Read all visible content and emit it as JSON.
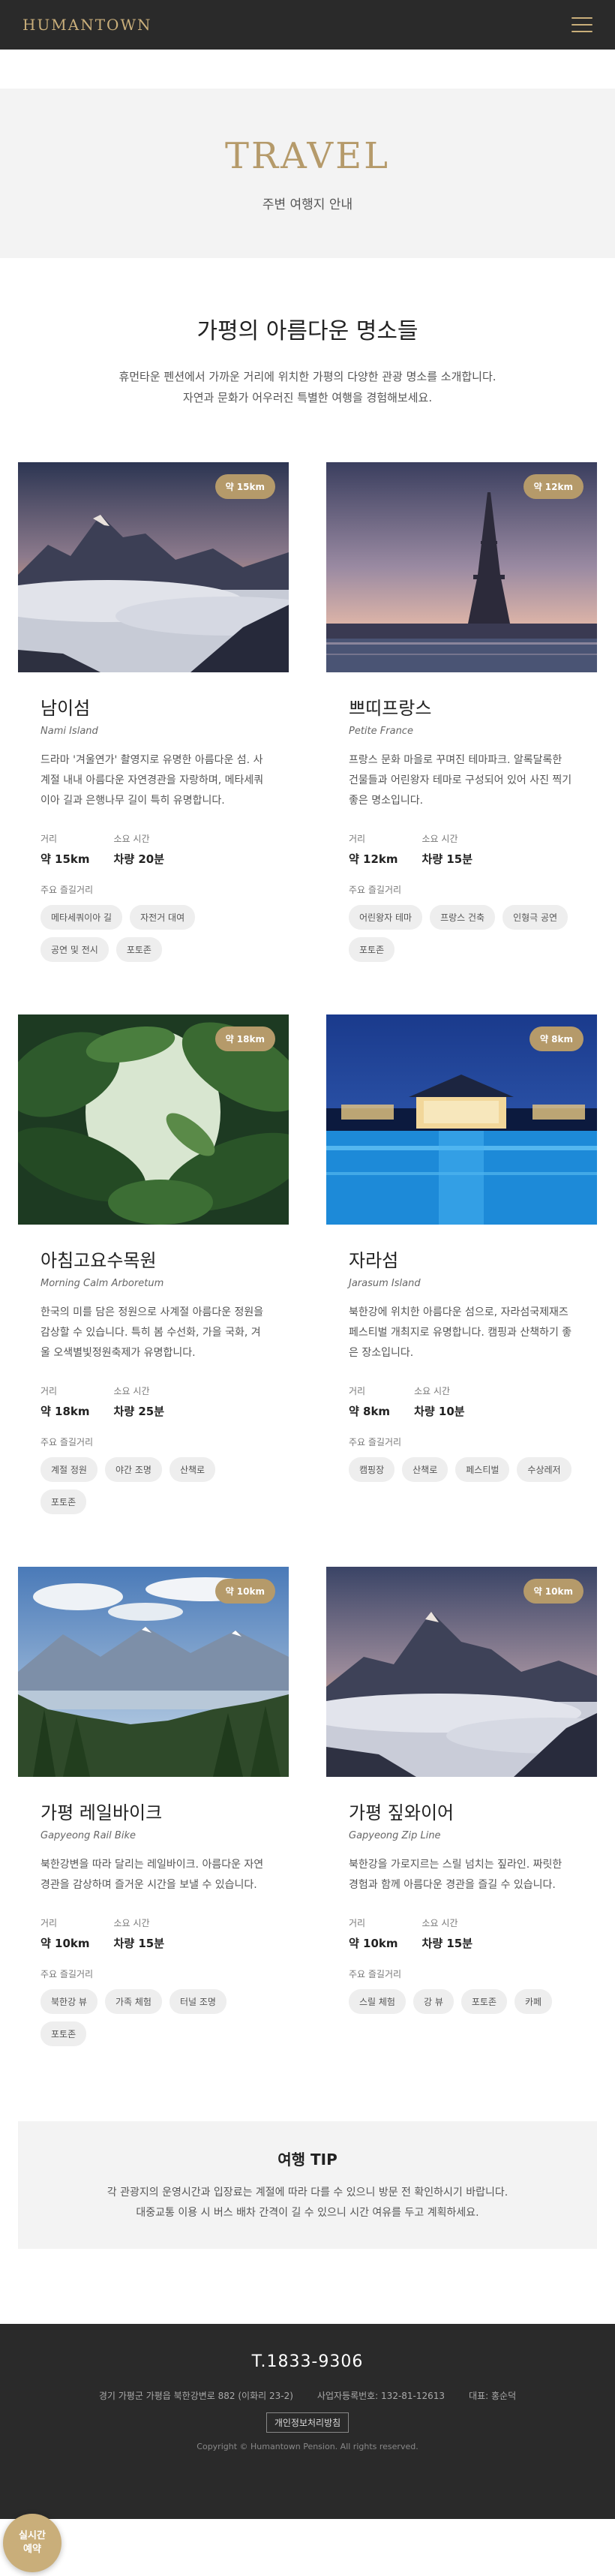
{
  "header": {
    "logo": "HUMANTOWN",
    "menu_icon": "hamburger-menu-icon"
  },
  "hero": {
    "title": "TRAVEL",
    "subtitle": "주변 여행지 안내"
  },
  "intro": {
    "title": "가평의 아름다운 명소들",
    "line1": "휴먼타운 펜션에서 가까운 거리에 위치한 가평의 다양한 관광 명소를 소개합니다.",
    "line2": "자연과 문화가 어우러진 특별한 여행을 경험해보세요."
  },
  "labels": {
    "distance": "거리",
    "time": "소요 시간",
    "spots": "주요 즐길거리"
  },
  "places": [
    {
      "badge": "약 15km",
      "title": "남이섬",
      "en": "Nami Island",
      "desc": "드라마 '겨울연가' 촬영지로 유명한 아름다운 섬. 사계절 내내 아름다운 자연경관을 자랑하며, 메타세쿼이아 길과 은행나무 길이 특히 유명합니다.",
      "distance": "약 15km",
      "time": "차량 20분",
      "tags": [
        "메타세쿼이아 길",
        "자전거 대여",
        "공연 및 전시",
        "포토존"
      ]
    },
    {
      "badge": "약 12km",
      "title": "쁘띠프랑스",
      "en": "Petite France",
      "desc": "프랑스 문화 마을로 꾸며진 테마파크. 알록달록한 건물들과 어린왕자 테마로 구성되어 있어 사진 찍기 좋은 명소입니다.",
      "distance": "약 12km",
      "time": "차량 15분",
      "tags": [
        "어린왕자 테마",
        "프랑스 건축",
        "인형극 공연",
        "포토존"
      ]
    },
    {
      "badge": "약 18km",
      "title": "아침고요수목원",
      "en": "Morning Calm Arboretum",
      "desc": "한국의 미를 담은 정원으로 사계절 아름다운 정원을 감상할 수 있습니다. 특히 봄 수선화, 가을 국화, 겨울 오색별빛정원축제가 유명합니다.",
      "distance": "약 18km",
      "time": "차량 25분",
      "tags": [
        "계절 정원",
        "야간 조명",
        "산책로",
        "포토존"
      ]
    },
    {
      "badge": "약 8km",
      "title": "자라섬",
      "en": "Jarasum Island",
      "desc": "북한강에 위치한 아름다운 섬으로, 자라섬국제재즈페스티벌 개최지로 유명합니다. 캠핑과 산책하기 좋은 장소입니다.",
      "distance": "약 8km",
      "time": "차량 10분",
      "tags": [
        "캠핑장",
        "산책로",
        "페스티벌",
        "수상레저"
      ]
    },
    {
      "badge": "약 10km",
      "title": "가평 레일바이크",
      "en": "Gapyeong Rail Bike",
      "desc": "북한강변을 따라 달리는 레일바이크. 아름다운 자연 경관을 감상하며 즐거운 시간을 보낼 수 있습니다.",
      "distance": "약 10km",
      "time": "차량 15분",
      "tags": [
        "북한강 뷰",
        "가족 체험",
        "터널 조명",
        "포토존"
      ]
    },
    {
      "badge": "약 10km",
      "title": "가평 짚와이어",
      "en": "Gapyeong Zip Line",
      "desc": "북한강을 가로지르는 스릴 넘치는 짚라인. 짜릿한 경험과 함께 아름다운 경관을 즐길 수 있습니다.",
      "distance": "약 10km",
      "time": "차량 15분",
      "tags": [
        "스릴 체험",
        "강 뷰",
        "포토존",
        "카페"
      ]
    }
  ],
  "tip": {
    "title": "여행 TIP",
    "line1": "각 관광지의 운영시간과 입장료는 계절에 따라 다를 수 있으니 방문 전 확인하시기 바랍니다.",
    "line2": "대중교통 이용 시 버스 배차 간격이 길 수 있으니 시간 여유를 두고 계획하세요."
  },
  "footer": {
    "phone": "T.1833-9306",
    "address": "경기 가평군 가평읍 북한강변로 882 (이화리 23-2)",
    "biz": "사업자등록번호: 132-81-12613",
    "ceo": "대표: 홍순덕",
    "privacy": "개인정보처리방침",
    "copyright": "Copyright © Humantown Pension. All rights reserved."
  },
  "reserve": {
    "line1": "실시간",
    "line2": "예약"
  },
  "colors": {
    "accent": "#b59a6a",
    "dark": "#2a2a2a",
    "light_bg": "#f3f3f3"
  }
}
